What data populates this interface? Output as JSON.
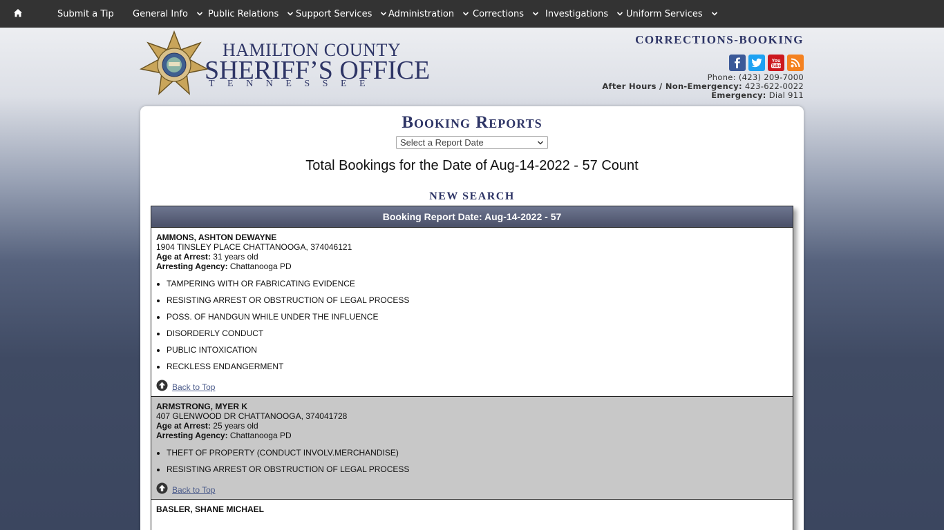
{
  "nav": {
    "items": [
      {
        "label": "Submit a Tip",
        "dropdown": false
      },
      {
        "label": "General Info",
        "dropdown": true
      },
      {
        "label": "Public Relations",
        "dropdown": true
      },
      {
        "label": "Support Services",
        "dropdown": true
      },
      {
        "label": "Administration",
        "dropdown": true
      },
      {
        "label": "Corrections",
        "dropdown": true
      },
      {
        "label": "Investigations",
        "dropdown": true
      },
      {
        "label": "Uniform Services",
        "dropdown": true
      }
    ]
  },
  "logo": {
    "line1": "HAMILTON COUNTY",
    "line2": "SHERIFF’S OFFICE",
    "line3": "TENNESSEE",
    "badge_text": "SHERIFF HAMILTON COUNTY"
  },
  "header": {
    "section_title": "CORRECTIONS-BOOKING",
    "phone_label": "Phone:",
    "phone": "(423) 209-7000",
    "after_hours_label": "After Hours / Non-Emergency:",
    "after_hours": "423-622-0022",
    "emergency_label": "Emergency:",
    "emergency": "Dial 911"
  },
  "social": [
    "facebook-icon",
    "twitter-icon",
    "youtube-icon",
    "rss-icon"
  ],
  "main": {
    "title": "Booking Reports",
    "select_placeholder": "Select a Report Date",
    "total": "Total Bookings for the Date of Aug-14-2022 - 57 Count",
    "new_search": "NEW SEARCH",
    "table_header": "Booking Report Date: Aug-14-2022 - 57",
    "back_to_top": "Back to Top",
    "age_label": "Age at Arrest:",
    "agency_label": "Arresting Agency:",
    "records": [
      {
        "name": "AMMONS, ASHTON DEWAYNE",
        "address": "1904 TINSLEY PLACE CHATTANOOGA, 374046121",
        "age": "31 years old",
        "agency": "Chattanooga PD",
        "charges": [
          "TAMPERING WITH OR FABRICATING EVIDENCE",
          "RESISTING ARREST OR OBSTRUCTION OF LEGAL PROCESS",
          "POSS. OF HANDGUN WHILE UNDER THE INFLUENCE",
          "DISORDERLY CONDUCT",
          "PUBLIC INTOXICATION",
          "RECKLESS ENDANGERMENT"
        ]
      },
      {
        "name": "ARMSTRONG, MYER K",
        "address": "407 GLENWOOD DR CHATTANOOGA, 374041728",
        "age": "25 years old",
        "agency": "Chattanooga PD",
        "charges": [
          "THEFT OF PROPERTY (CONDUCT INVOLV.MERCHANDISE)",
          "RESISTING ARREST OR OBSTRUCTION OF LEGAL PROCESS"
        ]
      },
      {
        "name": "BASLER, SHANE MICHAEL",
        "address": "",
        "age": "",
        "agency": "",
        "charges": []
      }
    ]
  },
  "colors": {
    "nav_bg": "#333333",
    "brand_navy": "#2e3566",
    "table_header": "#5a6079",
    "alt_row": "#c8c8c8"
  }
}
